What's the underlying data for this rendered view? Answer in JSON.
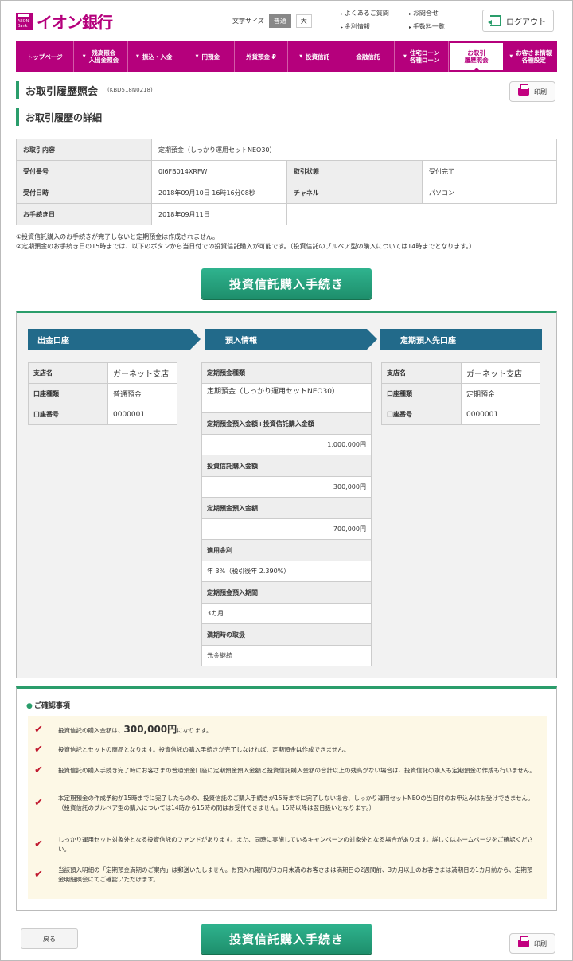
{
  "header": {
    "logo_text": "イオン銀行",
    "logo_small": "AEON Bank",
    "font_size_label": "文字サイズ",
    "font_normal": "普通",
    "font_large": "大",
    "links": [
      "よくあるご質問",
      "お問合せ",
      "金利情報",
      "手数料一覧"
    ],
    "logout": "ログアウト"
  },
  "nav": [
    {
      "label": "トップページ",
      "drop": false
    },
    {
      "label": "残高照会\n入出金照会",
      "drop": true
    },
    {
      "label": "振込・入金",
      "drop": true
    },
    {
      "label": "円預金",
      "drop": true
    },
    {
      "label": "外貨預金 ₽",
      "drop": false
    },
    {
      "label": "投資信託",
      "drop": true
    },
    {
      "label": "金融信託",
      "drop": false
    },
    {
      "label": "住宅ローン\n各種ローン",
      "drop": true
    },
    {
      "label": "お取引\n履歴照会",
      "drop": false,
      "active": true
    },
    {
      "label": "お客さま情報\n各種設定",
      "drop": true
    }
  ],
  "page": {
    "title": "お取引履歴照会",
    "code": "(KBD518N0218)",
    "subtitle": "お取引履歴の詳細",
    "print": "印刷"
  },
  "info": {
    "row1": {
      "label": "お取引内容",
      "value": "定期預金（しっかり運用セットNEO30）"
    },
    "row2": {
      "label": "受付番号",
      "value": "0I6FB014XRFW",
      "label2": "取引状態",
      "value2": "受付完了"
    },
    "row3": {
      "label": "受付日時",
      "value": "2018年09月10日 16時16分08秒",
      "label2": "チャネル",
      "value2": "パソコン"
    },
    "row4": {
      "label": "お手続き日",
      "value": "2018年09月11日"
    }
  },
  "notes": [
    "①投資信託購入のお手続きが完了しないと定期預金は作成されません。",
    "②定期預金のお手続き日の15時までは、以下のボタンから当日付での投資信託購入が可能です。（投資信託のブルベア型の購入については14時までとなります。）"
  ],
  "buy_button": "投資信託購入手続き",
  "flow": {
    "col1": {
      "title": "出金口座",
      "rows": [
        {
          "label": "支店名",
          "value": "ガーネット支店"
        },
        {
          "label": "口座種類",
          "value": "普通預金"
        },
        {
          "label": "口座番号",
          "value": "0000001"
        }
      ]
    },
    "col2": {
      "title": "預入情報",
      "items": [
        {
          "label": "定期預金種類",
          "value": "定期預金（しっかり運用セットNEO30）"
        },
        {
          "label": "定期預金預入金額+投資信託購入金額",
          "value": "1,000,000円"
        },
        {
          "label": "投資信託購入金額",
          "value": "300,000円"
        },
        {
          "label": "定期預金預入金額",
          "value": "700,000円"
        },
        {
          "label": "適用金利",
          "value": "年 3%（税引後年 2.390%）"
        },
        {
          "label": "定期預金預入期間",
          "value": "3カ月"
        },
        {
          "label": "満期時の取扱",
          "value": "元金継続"
        }
      ]
    },
    "col3": {
      "title": "定期預入先口座",
      "rows": [
        {
          "label": "支店名",
          "value": "ガーネット支店"
        },
        {
          "label": "口座種類",
          "value": "定期預金"
        },
        {
          "label": "口座番号",
          "value": "0000001"
        }
      ]
    }
  },
  "confirm": {
    "title": "ご確認事項",
    "item1_pre": "投資信託の購入金額は、",
    "item1_amount": "300,000円",
    "item1_post": "になります。",
    "item2": "投資信託とセットの商品となります。投資信託の購入手続きが完了しなければ、定期預金は作成できません。",
    "item3": "投資信託の購入手続き完了時にお客さまの普通預金口座に定期預金預入金額と投資信託購入金額の合計以上の残高がない場合は、投資信託の購入も定期預金の作成も行いません。",
    "item4": "本定期預金の作成予約が15時までに完了したものの、投資信託のご購入手続きが15時までに完了しない場合、しっかり運用セットNEOの当日付のお申込みはお受けできません。（投資信託のブルベア型の購入については14時から15時の間はお受付できません。15時以降は翌日扱いとなります。）",
    "item5": "しっかり運用セット対象外となる投資信託のファンドがあります。また、同時に実施しているキャンペーンの対象外となる場合があります。詳しくはホームページをご確認ください。",
    "item6": "当該預入明細の「定期預金満期のご案内」は郵送いたしません。お預入れ期間が3カ月未満のお客さまは満期日の2週間前、3カ月以上のお客さまは満期日の1カ月前から、定期預金明細照会にてご確認いただけます。"
  },
  "back": "戻る",
  "colors": {
    "brand": "#b5007c",
    "accent_green": "#2a9d6b",
    "flow_header": "#226a8a",
    "check_red": "#c0182e"
  }
}
